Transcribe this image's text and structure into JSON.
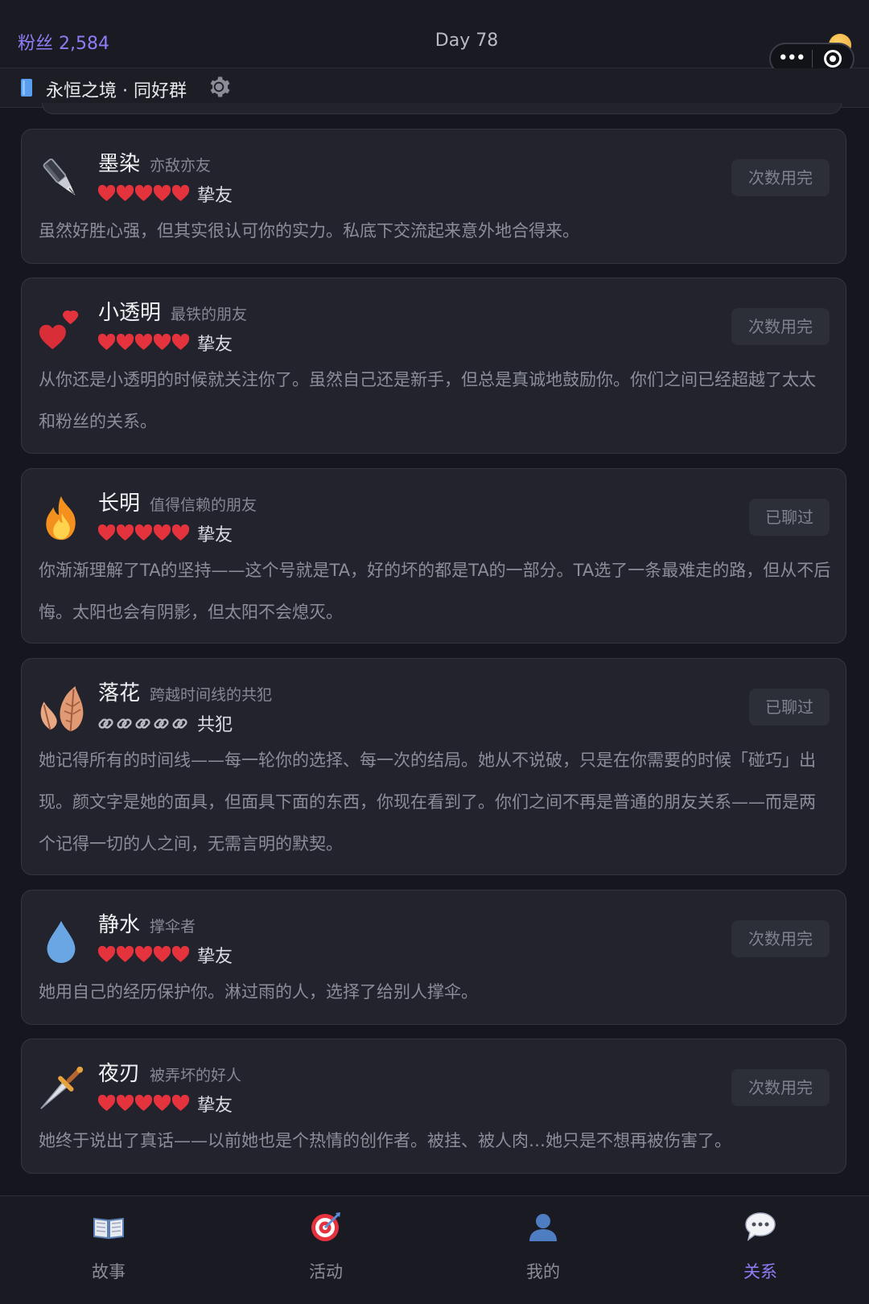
{
  "header": {
    "fans": "粉丝 2,584",
    "day": "Day 78"
  },
  "group": {
    "name": "永恒之境 · 同好群"
  },
  "cards": [
    {
      "name": "墨染",
      "role": "亦敌亦友",
      "level": "挚友",
      "level_icon": "heart",
      "level_count": 5,
      "desc": "虽然好胜心强，但其实很认可你的实力。私底下交流起来意外地合得来。",
      "button": "次数用完",
      "avatar_icon": "pen-icon"
    },
    {
      "name": "小透明",
      "role": "最铁的朋友",
      "level": "挚友",
      "level_icon": "heart",
      "level_count": 5,
      "desc": "从你还是小透明的时候就关注你了。虽然自己还是新手，但总是真诚地鼓励你。你们之间已经超越了太太和粉丝的关系。",
      "button": "次数用完",
      "avatar_icon": "two-hearts-icon"
    },
    {
      "name": "长明",
      "role": "值得信赖的朋友",
      "level": "挚友",
      "level_icon": "heart",
      "level_count": 5,
      "desc": "你渐渐理解了TA的坚持——这个号就是TA，好的坏的都是TA的一部分。TA选了一条最难走的路，但从不后悔。太阳也会有阴影，但太阳不会熄灭。",
      "button": "已聊过",
      "avatar_icon": "fire-icon"
    },
    {
      "name": "落花",
      "role": "跨越时间线的共犯",
      "level": "共犯",
      "level_icon": "link",
      "level_count": 5,
      "desc": "她记得所有的时间线——每一轮你的选择、每一次的结局。她从不说破，只是在你需要的时候「碰巧」出现。颜文字是她的面具，但面具下面的东西，你现在看到了。你们之间不再是普通的朋友关系——而是两个记得一切的人之间，无需言明的默契。",
      "button": "已聊过",
      "avatar_icon": "fallen-leaves-icon"
    },
    {
      "name": "静水",
      "role": "撑伞者",
      "level": "挚友",
      "level_icon": "heart",
      "level_count": 5,
      "desc": "她用自己的经历保护你。淋过雨的人，选择了给别人撑伞。",
      "button": "次数用完",
      "avatar_icon": "droplet-icon"
    },
    {
      "name": "夜刃",
      "role": "被弄坏的好人",
      "level": "挚友",
      "level_icon": "heart",
      "level_count": 5,
      "desc": "她终于说出了真话——以前她也是个热情的创作者。被挂、被人肉…她只是不想再被伤害了。",
      "button": "次数用完",
      "avatar_icon": "dagger-icon"
    }
  ],
  "tabs": [
    {
      "label": "故事",
      "icon": "book-icon"
    },
    {
      "label": "活动",
      "icon": "target-icon"
    },
    {
      "label": "我的",
      "icon": "user-icon"
    },
    {
      "label": "关系",
      "icon": "chat-bubble-icon",
      "active": true
    }
  ],
  "colors": {
    "accent": "#8f7cf6",
    "heart": "#e5333d",
    "background": "#16171e",
    "card": "#22232c"
  }
}
